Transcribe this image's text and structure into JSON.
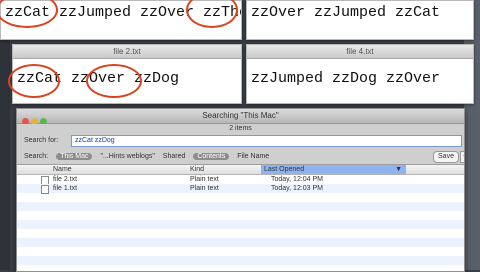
{
  "editors": {
    "top_left": {
      "text": "zzCat zzJumped zzOver zzThe zzDog"
    },
    "top_right": {
      "text": "zzOver zzJumped zzCat"
    },
    "bottom_left": {
      "title": "file 2.txt",
      "text": "zzCat zzOver zzDog"
    },
    "bottom_right": {
      "title": "file 4.txt",
      "text": "zzJumped zzDog zzOver"
    }
  },
  "finder": {
    "title": "Searching \"This Mac\"",
    "item_count": "2 items",
    "search_label": "Search for:",
    "search_value": "zzCat zzDog",
    "scope_label": "Search:",
    "scopes": [
      "This Mac",
      "\"...Hints weblogs\"",
      "Shared"
    ],
    "criteria": [
      "Contents",
      "File Name"
    ],
    "save_label": "Save",
    "plus_label": "+",
    "columns": {
      "name": "Name",
      "kind": "Kind",
      "last_opened": "Last Opened"
    },
    "files": [
      {
        "name": "file 2.txt",
        "kind": "Plain text",
        "date": "Today, 12:04 PM"
      },
      {
        "name": "file 1.txt",
        "kind": "Plain text",
        "date": "Today, 12:03 PM"
      }
    ]
  },
  "colors": {
    "highlight_circle": "#d9431e",
    "selected_column": "#8fb3ee"
  }
}
